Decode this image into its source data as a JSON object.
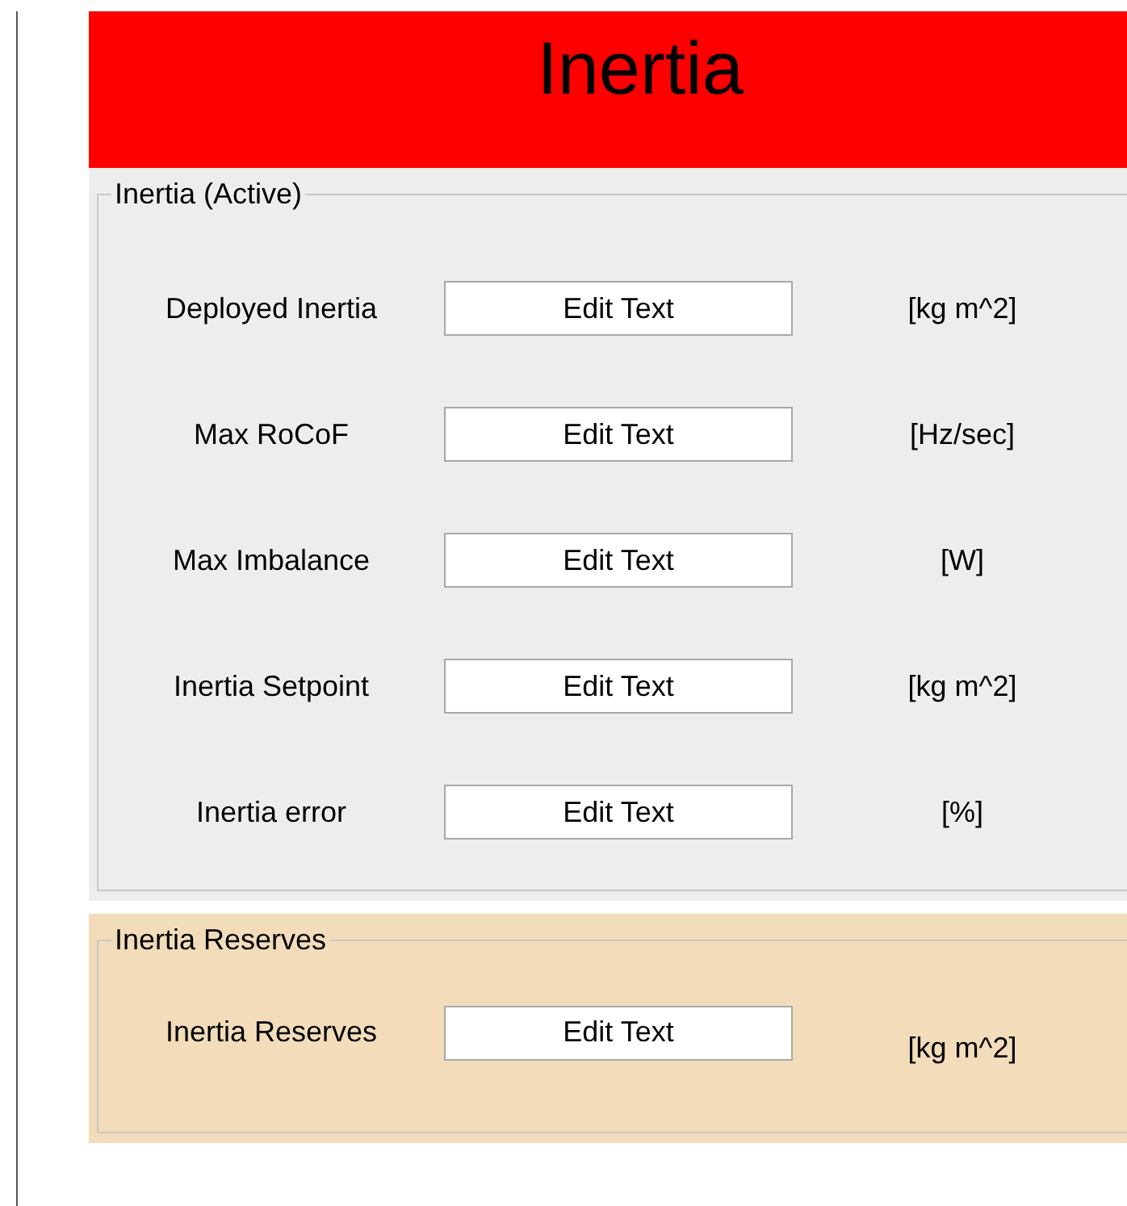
{
  "title": "Inertia",
  "panels": [
    {
      "title": "Inertia (Active)",
      "kind": "active",
      "rows": [
        {
          "label": "Deployed Inertia",
          "value": "Edit Text",
          "unit": "[kg m^2]"
        },
        {
          "label": "Max RoCoF",
          "value": "Edit Text",
          "unit": "[Hz/sec]"
        },
        {
          "label": "Max Imbalance",
          "value": "Edit Text",
          "unit": "[W]"
        },
        {
          "label": "Inertia Setpoint",
          "value": "Edit Text",
          "unit": "[kg m^2]"
        },
        {
          "label": "Inertia error",
          "value": "Edit Text",
          "unit": "[%]"
        }
      ]
    },
    {
      "title": "Inertia Reserves",
      "kind": "reserves",
      "rows": [
        {
          "label": "Inertia Reserves",
          "value": "Edit Text",
          "unit": "[kg m^2]"
        }
      ]
    }
  ]
}
